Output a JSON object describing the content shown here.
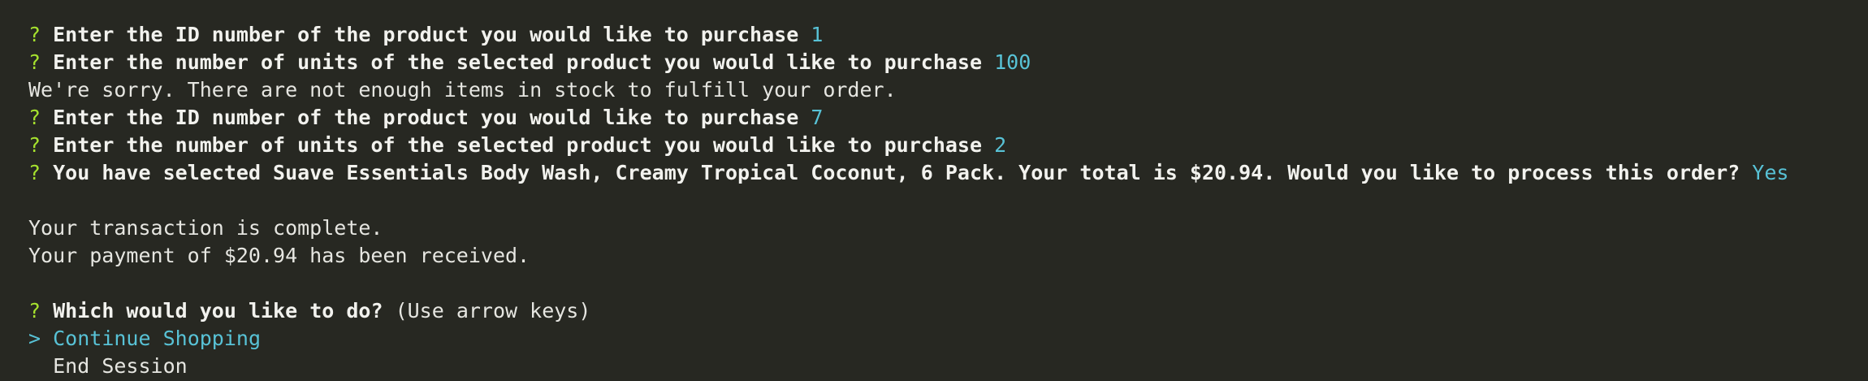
{
  "terminal": {
    "prompt_symbol": "?",
    "lines": [
      {
        "question": "Enter the ID number of the product you would like to purchase",
        "answer": "1"
      },
      {
        "question": "Enter the number of units of the selected product you would like to purchase",
        "answer": "100"
      },
      {
        "text": "We're sorry. There are not enough items in stock to fulfill your order."
      },
      {
        "question": "Enter the ID number of the product you would like to purchase",
        "answer": "7"
      },
      {
        "question": "Enter the number of units of the selected product you would like to purchase",
        "answer": "2"
      },
      {
        "question": "You have selected Suave Essentials Body Wash, Creamy Tropical Coconut, 6 Pack. Your total is $20.94. Would you like to process this order?",
        "answer": "Yes"
      },
      {
        "text": "Your transaction is complete."
      },
      {
        "text": "Your payment of $20.94 has been received."
      }
    ],
    "menu": {
      "question": "Which would you like to do?",
      "hint": "(Use arrow keys)",
      "pointer": ">",
      "options": [
        "Continue Shopping",
        "End Session"
      ],
      "selected_index": 0
    }
  },
  "colors": {
    "background": "#272822",
    "prompt_symbol": "#a6e22e",
    "answer": "#58c2d6",
    "text": "#e6e6e1"
  }
}
